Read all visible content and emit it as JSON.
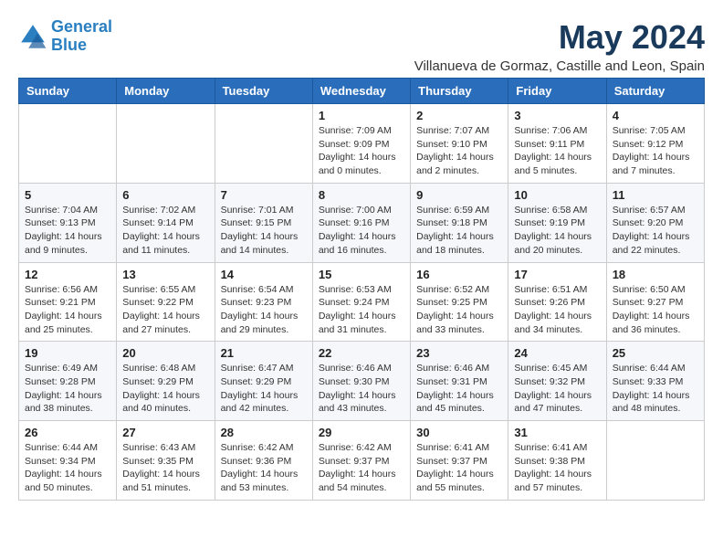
{
  "header": {
    "logo_line1": "General",
    "logo_line2": "Blue",
    "month_title": "May 2024",
    "location": "Villanueva de Gormaz, Castille and Leon, Spain"
  },
  "days_of_week": [
    "Sunday",
    "Monday",
    "Tuesday",
    "Wednesday",
    "Thursday",
    "Friday",
    "Saturday"
  ],
  "weeks": [
    [
      {
        "day": "",
        "info": ""
      },
      {
        "day": "",
        "info": ""
      },
      {
        "day": "",
        "info": ""
      },
      {
        "day": "1",
        "info": "Sunrise: 7:09 AM\nSunset: 9:09 PM\nDaylight: 14 hours\nand 0 minutes."
      },
      {
        "day": "2",
        "info": "Sunrise: 7:07 AM\nSunset: 9:10 PM\nDaylight: 14 hours\nand 2 minutes."
      },
      {
        "day": "3",
        "info": "Sunrise: 7:06 AM\nSunset: 9:11 PM\nDaylight: 14 hours\nand 5 minutes."
      },
      {
        "day": "4",
        "info": "Sunrise: 7:05 AM\nSunset: 9:12 PM\nDaylight: 14 hours\nand 7 minutes."
      }
    ],
    [
      {
        "day": "5",
        "info": "Sunrise: 7:04 AM\nSunset: 9:13 PM\nDaylight: 14 hours\nand 9 minutes."
      },
      {
        "day": "6",
        "info": "Sunrise: 7:02 AM\nSunset: 9:14 PM\nDaylight: 14 hours\nand 11 minutes."
      },
      {
        "day": "7",
        "info": "Sunrise: 7:01 AM\nSunset: 9:15 PM\nDaylight: 14 hours\nand 14 minutes."
      },
      {
        "day": "8",
        "info": "Sunrise: 7:00 AM\nSunset: 9:16 PM\nDaylight: 14 hours\nand 16 minutes."
      },
      {
        "day": "9",
        "info": "Sunrise: 6:59 AM\nSunset: 9:18 PM\nDaylight: 14 hours\nand 18 minutes."
      },
      {
        "day": "10",
        "info": "Sunrise: 6:58 AM\nSunset: 9:19 PM\nDaylight: 14 hours\nand 20 minutes."
      },
      {
        "day": "11",
        "info": "Sunrise: 6:57 AM\nSunset: 9:20 PM\nDaylight: 14 hours\nand 22 minutes."
      }
    ],
    [
      {
        "day": "12",
        "info": "Sunrise: 6:56 AM\nSunset: 9:21 PM\nDaylight: 14 hours\nand 25 minutes."
      },
      {
        "day": "13",
        "info": "Sunrise: 6:55 AM\nSunset: 9:22 PM\nDaylight: 14 hours\nand 27 minutes."
      },
      {
        "day": "14",
        "info": "Sunrise: 6:54 AM\nSunset: 9:23 PM\nDaylight: 14 hours\nand 29 minutes."
      },
      {
        "day": "15",
        "info": "Sunrise: 6:53 AM\nSunset: 9:24 PM\nDaylight: 14 hours\nand 31 minutes."
      },
      {
        "day": "16",
        "info": "Sunrise: 6:52 AM\nSunset: 9:25 PM\nDaylight: 14 hours\nand 33 minutes."
      },
      {
        "day": "17",
        "info": "Sunrise: 6:51 AM\nSunset: 9:26 PM\nDaylight: 14 hours\nand 34 minutes."
      },
      {
        "day": "18",
        "info": "Sunrise: 6:50 AM\nSunset: 9:27 PM\nDaylight: 14 hours\nand 36 minutes."
      }
    ],
    [
      {
        "day": "19",
        "info": "Sunrise: 6:49 AM\nSunset: 9:28 PM\nDaylight: 14 hours\nand 38 minutes."
      },
      {
        "day": "20",
        "info": "Sunrise: 6:48 AM\nSunset: 9:29 PM\nDaylight: 14 hours\nand 40 minutes."
      },
      {
        "day": "21",
        "info": "Sunrise: 6:47 AM\nSunset: 9:29 PM\nDaylight: 14 hours\nand 42 minutes."
      },
      {
        "day": "22",
        "info": "Sunrise: 6:46 AM\nSunset: 9:30 PM\nDaylight: 14 hours\nand 43 minutes."
      },
      {
        "day": "23",
        "info": "Sunrise: 6:46 AM\nSunset: 9:31 PM\nDaylight: 14 hours\nand 45 minutes."
      },
      {
        "day": "24",
        "info": "Sunrise: 6:45 AM\nSunset: 9:32 PM\nDaylight: 14 hours\nand 47 minutes."
      },
      {
        "day": "25",
        "info": "Sunrise: 6:44 AM\nSunset: 9:33 PM\nDaylight: 14 hours\nand 48 minutes."
      }
    ],
    [
      {
        "day": "26",
        "info": "Sunrise: 6:44 AM\nSunset: 9:34 PM\nDaylight: 14 hours\nand 50 minutes."
      },
      {
        "day": "27",
        "info": "Sunrise: 6:43 AM\nSunset: 9:35 PM\nDaylight: 14 hours\nand 51 minutes."
      },
      {
        "day": "28",
        "info": "Sunrise: 6:42 AM\nSunset: 9:36 PM\nDaylight: 14 hours\nand 53 minutes."
      },
      {
        "day": "29",
        "info": "Sunrise: 6:42 AM\nSunset: 9:37 PM\nDaylight: 14 hours\nand 54 minutes."
      },
      {
        "day": "30",
        "info": "Sunrise: 6:41 AM\nSunset: 9:37 PM\nDaylight: 14 hours\nand 55 minutes."
      },
      {
        "day": "31",
        "info": "Sunrise: 6:41 AM\nSunset: 9:38 PM\nDaylight: 14 hours\nand 57 minutes."
      },
      {
        "day": "",
        "info": ""
      }
    ]
  ]
}
